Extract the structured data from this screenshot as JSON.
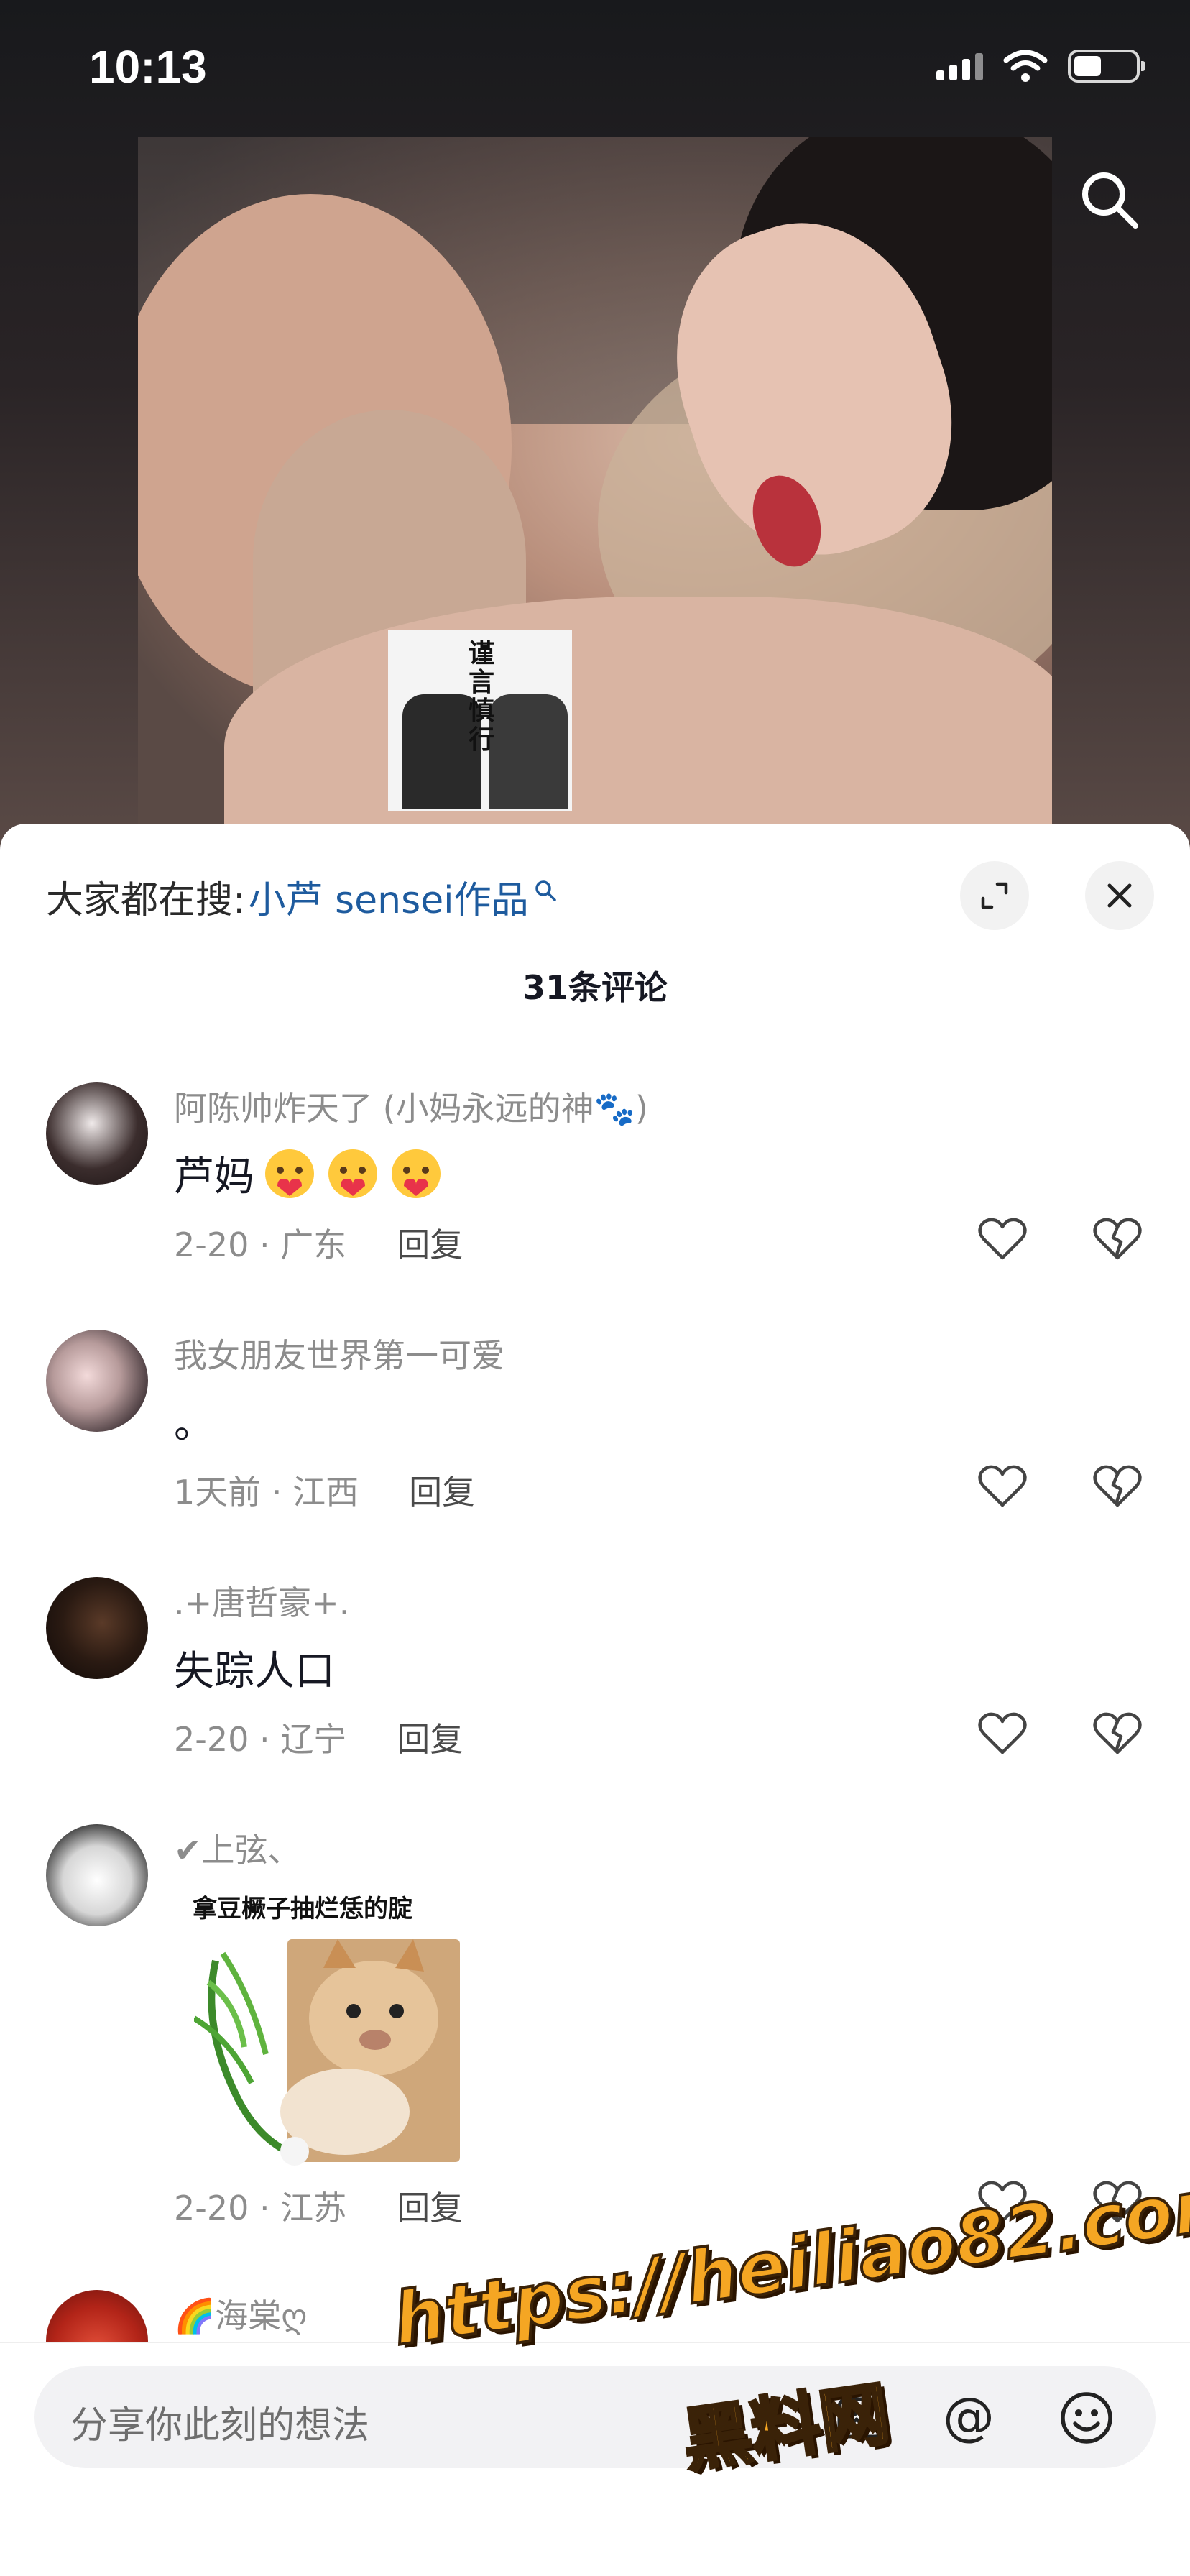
{
  "status_bar": {
    "time": "10:13"
  },
  "video": {
    "sticker_caption": "谨言慎行"
  },
  "sheet": {
    "hot_search_prefix": "大家都在搜:",
    "hot_search_link": "小芦 sensei作品",
    "comment_count": "31条评论"
  },
  "comments": [
    {
      "name": "阿陈帅炸天了 (小妈永远的神🐾)",
      "text": "芦妈",
      "meta": "2-20 · 广东",
      "reply": "回复"
    },
    {
      "name": "我女朋友世界第一可爱",
      "text": "。",
      "meta": "1天前 · 江西",
      "reply": "回复"
    },
    {
      "name": ".+唐哲豪+.",
      "text": "失踪人口",
      "meta": "2-20 · 辽宁",
      "reply": "回复"
    },
    {
      "name": "✔上弦、",
      "sticker_caption": "拿豆橛子抽烂恁的腚",
      "meta": "2-20 · 江苏",
      "reply": "回复"
    },
    {
      "name": "🌈海棠ღ"
    }
  ],
  "input": {
    "placeholder": "分享你此刻的想法",
    "at_label": "@"
  },
  "watermark": {
    "line1": "https://heiliao82.com",
    "line2": "黑料网"
  },
  "colors": {
    "link": "#1e5b9e",
    "meta": "#8c8c8c",
    "sheet_bg": "#ffffff",
    "watermark": "#f5a623"
  },
  "icons": [
    "search-icon",
    "expand-icon",
    "close-icon",
    "heart-icon",
    "broken-heart-icon",
    "at-icon",
    "emoji-icon",
    "image-icon"
  ]
}
